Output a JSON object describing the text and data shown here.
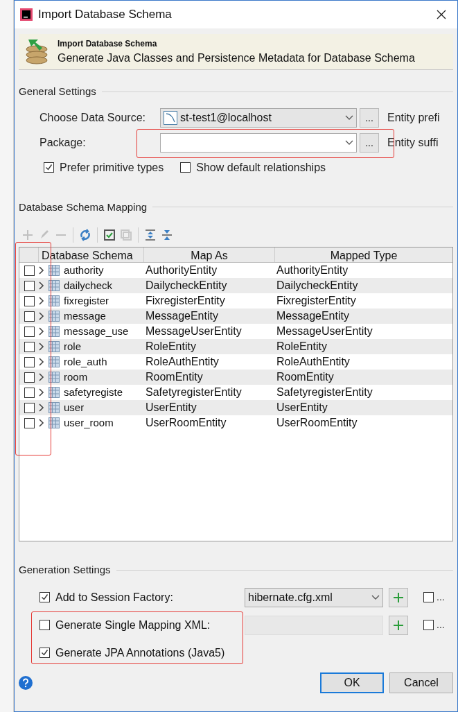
{
  "window": {
    "title": "Import Database Schema"
  },
  "header": {
    "title": "Import Database Schema",
    "subtitle": "Generate Java Classes and Persistence Metadata for Database Schema"
  },
  "general_settings": {
    "title": "General Settings",
    "data_source": {
      "label": "Choose Data Source:",
      "value": "st-test1@localhost",
      "browse": "...",
      "side_label": "Entity prefi"
    },
    "package": {
      "label": "Package:",
      "browse": "...",
      "side_label": "Entity suffi"
    },
    "options": [
      {
        "label": "Prefer primitive types",
        "checked": true
      },
      {
        "label": "Show default relationships",
        "checked": false
      }
    ]
  },
  "mapping": {
    "title": "Database Schema Mapping",
    "toolbar": [
      {
        "kind": "plus",
        "disabled": true
      },
      {
        "kind": "pencil",
        "disabled": true
      },
      {
        "kind": "minus",
        "disabled": true
      },
      {
        "kind": "refresh",
        "disabled": false
      },
      {
        "kind": "check-all",
        "disabled": false
      },
      {
        "kind": "uncheck-all",
        "disabled": true
      },
      {
        "kind": "expand",
        "disabled": false
      },
      {
        "kind": "collapse",
        "disabled": false
      }
    ],
    "columns": [
      "Database Schema",
      "Map As",
      "Mapped Type"
    ],
    "rows": [
      {
        "checked": false,
        "schema": "authority",
        "map_as": "AuthorityEntity",
        "type": "AuthorityEntity"
      },
      {
        "checked": false,
        "schema": "dailycheck",
        "map_as": "DailycheckEntity",
        "type": "DailycheckEntity"
      },
      {
        "checked": false,
        "schema": "fixregister",
        "map_as": "FixregisterEntity",
        "type": "FixregisterEntity"
      },
      {
        "checked": false,
        "schema": "message",
        "map_as": "MessageEntity",
        "type": "MessageEntity"
      },
      {
        "checked": false,
        "schema": "message_use",
        "map_as": "MessageUserEntity",
        "type": "MessageUserEntity"
      },
      {
        "checked": false,
        "schema": "role",
        "map_as": "RoleEntity",
        "type": "RoleEntity"
      },
      {
        "checked": false,
        "schema": "role_auth",
        "map_as": "RoleAuthEntity",
        "type": "RoleAuthEntity"
      },
      {
        "checked": false,
        "schema": "room",
        "map_as": "RoomEntity",
        "type": "RoomEntity"
      },
      {
        "checked": false,
        "schema": "safetyregiste",
        "map_as": "SafetyregisterEntity",
        "type": "SafetyregisterEntity"
      },
      {
        "checked": false,
        "schema": "user",
        "map_as": "UserEntity",
        "type": "UserEntity"
      },
      {
        "checked": false,
        "schema": "user_room",
        "map_as": "UserRoomEntity",
        "type": "UserRoomEntity"
      }
    ]
  },
  "generation_settings": {
    "title": "Generation Settings",
    "items": [
      {
        "label": "Add to Session Factory:",
        "checked": true,
        "field": "hibernate.cfg.xml",
        "field_disabled": false,
        "side_checked": false,
        "side_label": "..."
      },
      {
        "label": "Generate Single Mapping XML:",
        "checked": false,
        "field_disabled": true,
        "side_checked": false,
        "side_label": "..."
      },
      {
        "label": "Generate JPA Annotations (Java5)",
        "checked": true
      }
    ]
  },
  "buttons": [
    {
      "label": "OK",
      "default": true
    },
    {
      "label": "Cancel",
      "default": false
    }
  ]
}
